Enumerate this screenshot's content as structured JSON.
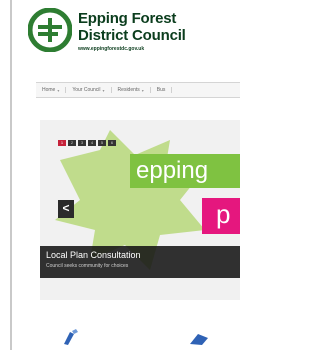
{
  "header": {
    "title_line1": "Epping Forest",
    "title_line2": "District Council",
    "url": "www.eppingforestdc.gov.uk",
    "logo_icon": "efdc-logo-icon"
  },
  "nav": {
    "items": [
      {
        "label": "Home"
      },
      {
        "label": "Your Council"
      },
      {
        "label": "Residents"
      },
      {
        "label": "Bus"
      }
    ]
  },
  "banner": {
    "slides": [
      "1",
      "2",
      "3",
      "4",
      "5",
      "6"
    ],
    "active_slide": 1,
    "headline_word1": "epping",
    "headline_word2": "p",
    "prev_label": "<",
    "caption_title": "Local Plan Consultation",
    "caption_subtitle": "Council seeks community for choices",
    "colors": {
      "green": "#7fc241",
      "pink": "#e5177e",
      "brand": "#0b3d1d"
    }
  }
}
